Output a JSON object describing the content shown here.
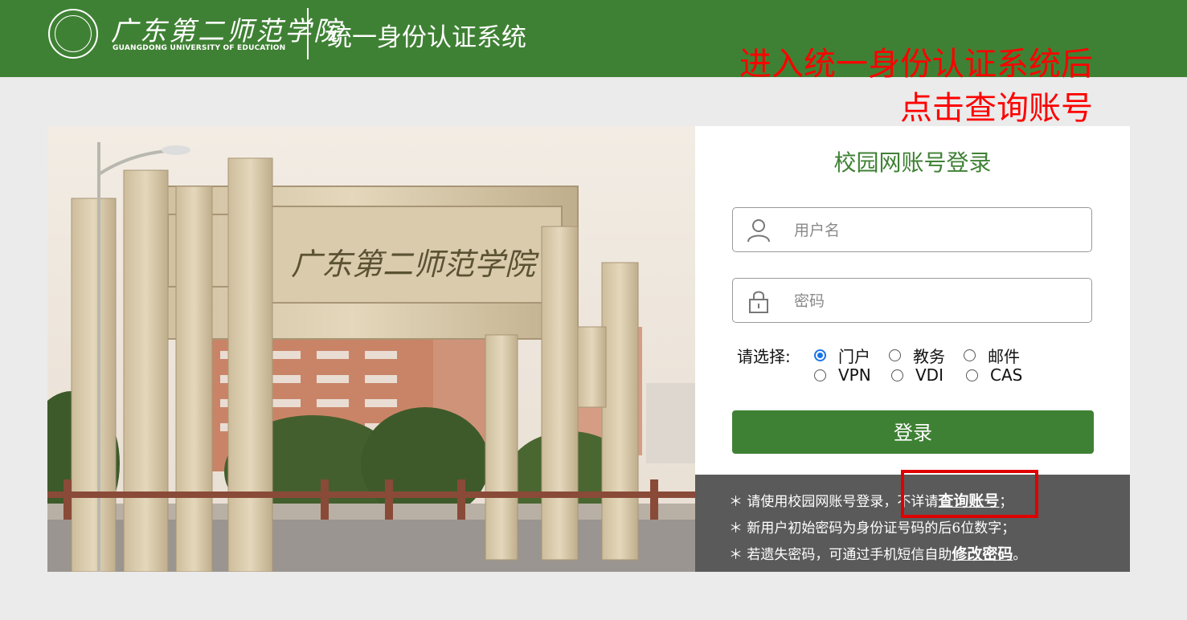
{
  "header": {
    "logo_cn": "广东第二师范学院",
    "logo_en": "GUANGDONG UNIVERSITY OF EDUCATION",
    "system_title": "统一身份认证系统",
    "bg_color": "#3f8134"
  },
  "annotation": {
    "line1": "进入统一身份认证系统后",
    "line2": "点击查询账号",
    "color": "#ff0000"
  },
  "photo": {
    "gate_inscription": "广东第二师范学院"
  },
  "login": {
    "title": "校园网账号登录",
    "username_placeholder": "用户名",
    "password_placeholder": "密码",
    "choose_label": "请选择:",
    "options": [
      {
        "label": "门户",
        "checked": true
      },
      {
        "label": "教务",
        "checked": false
      },
      {
        "label": "邮件",
        "checked": false
      },
      {
        "label": "VPN",
        "checked": false
      },
      {
        "label": "VDI",
        "checked": false
      },
      {
        "label": "CAS",
        "checked": false
      }
    ],
    "submit_label": "登录"
  },
  "notice": {
    "line1_text": "请使用校园网账号登录，不详请",
    "line1_link": "查询账号",
    "line1_end": "；",
    "line2_text": "新用户初始密码为身份证号码的后6位数字；",
    "line3_text": "若遗失密码，可通过手机短信自助",
    "line3_link": "修改密码",
    "line3_end": "。",
    "bullet": "＊"
  }
}
